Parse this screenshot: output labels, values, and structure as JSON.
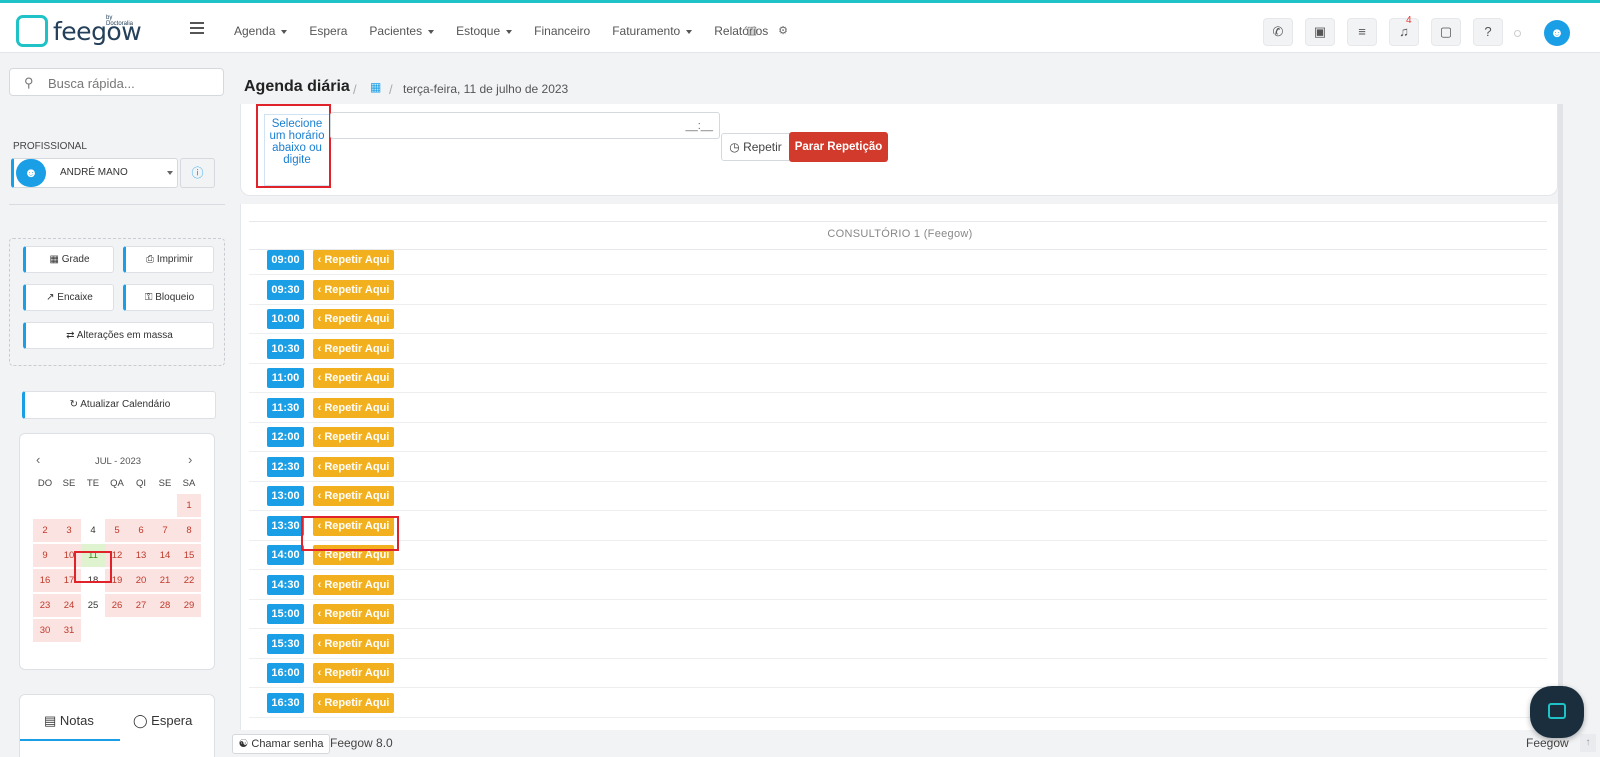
{
  "topbar": {
    "logo_text": "feegow",
    "logo_sub": "by Doctoralia",
    "nav": [
      {
        "label": "Agenda",
        "dropdown": true
      },
      {
        "label": "Espera",
        "dropdown": false
      },
      {
        "label": "Pacientes",
        "dropdown": true
      },
      {
        "label": "Estoque",
        "dropdown": true
      },
      {
        "label": "Financeiro",
        "dropdown": false
      },
      {
        "label": "Faturamento",
        "dropdown": true
      },
      {
        "label": "Relatórios",
        "dropdown": false
      }
    ],
    "notification_count": "4",
    "icons": [
      "phone-icon",
      "inbox-icon",
      "checklist-icon",
      "bell-icon",
      "chat-icon",
      "help-icon",
      "user-icon"
    ]
  },
  "sidebar": {
    "search_placeholder": "Busca rápida...",
    "profissional_label": "PROFISSIONAL",
    "profissional_name": "ANDRÉ MANO",
    "tools": {
      "grade": "Grade",
      "imprimir": "Imprimir",
      "encaixe": "Encaixe",
      "bloqueio": "Bloqueio",
      "alteracoes": "Alterações em massa"
    },
    "refresh": "Atualizar Calendário",
    "calendar": {
      "month": "JUL - 2023",
      "dow": [
        "DO",
        "SE",
        "TE",
        "QA",
        "QI",
        "SE",
        "SA"
      ],
      "selected_day": "11",
      "weeks": [
        [
          "",
          "",
          "",
          "",
          "",
          "",
          "1"
        ],
        [
          "2",
          "3",
          "4",
          "5",
          "6",
          "7",
          "8"
        ],
        [
          "9",
          "10",
          "11",
          "12",
          "13",
          "14",
          "15"
        ],
        [
          "16",
          "17",
          "18",
          "19",
          "20",
          "21",
          "22"
        ],
        [
          "23",
          "24",
          "25",
          "26",
          "27",
          "28",
          "29"
        ],
        [
          "30",
          "31",
          "",
          "",
          "",
          "",
          ""
        ]
      ],
      "plain_days": [
        "4",
        "18",
        "25"
      ]
    },
    "notes_tab": "Notas",
    "espera_tab": "Espera"
  },
  "main": {
    "title": "Agenda diária",
    "date": "terça-feira, 11 de julho de 2023",
    "time_hint": "Selecione um horário abaixo ou digite",
    "time_mask": "__:__",
    "repetir_label": "Repetir",
    "parar_label": "Parar Repetição",
    "room": "CONSULTÓRIO 1 (Feegow)",
    "slot_button": "Repetir Aqui",
    "slots": [
      "09:00",
      "09:30",
      "10:00",
      "10:30",
      "11:00",
      "11:30",
      "12:00",
      "12:30",
      "13:00",
      "13:30",
      "14:00",
      "14:30",
      "15:00",
      "15:30",
      "16:00",
      "16:30"
    ]
  },
  "footer": {
    "chamar": "Chamar senha",
    "version": "Feegow 8.0",
    "brand": "Feegow"
  },
  "colors": {
    "accent": "#1a9fe6",
    "brand": "#1fc2c6",
    "danger": "#d23b2c",
    "warning": "#f2b01e"
  }
}
